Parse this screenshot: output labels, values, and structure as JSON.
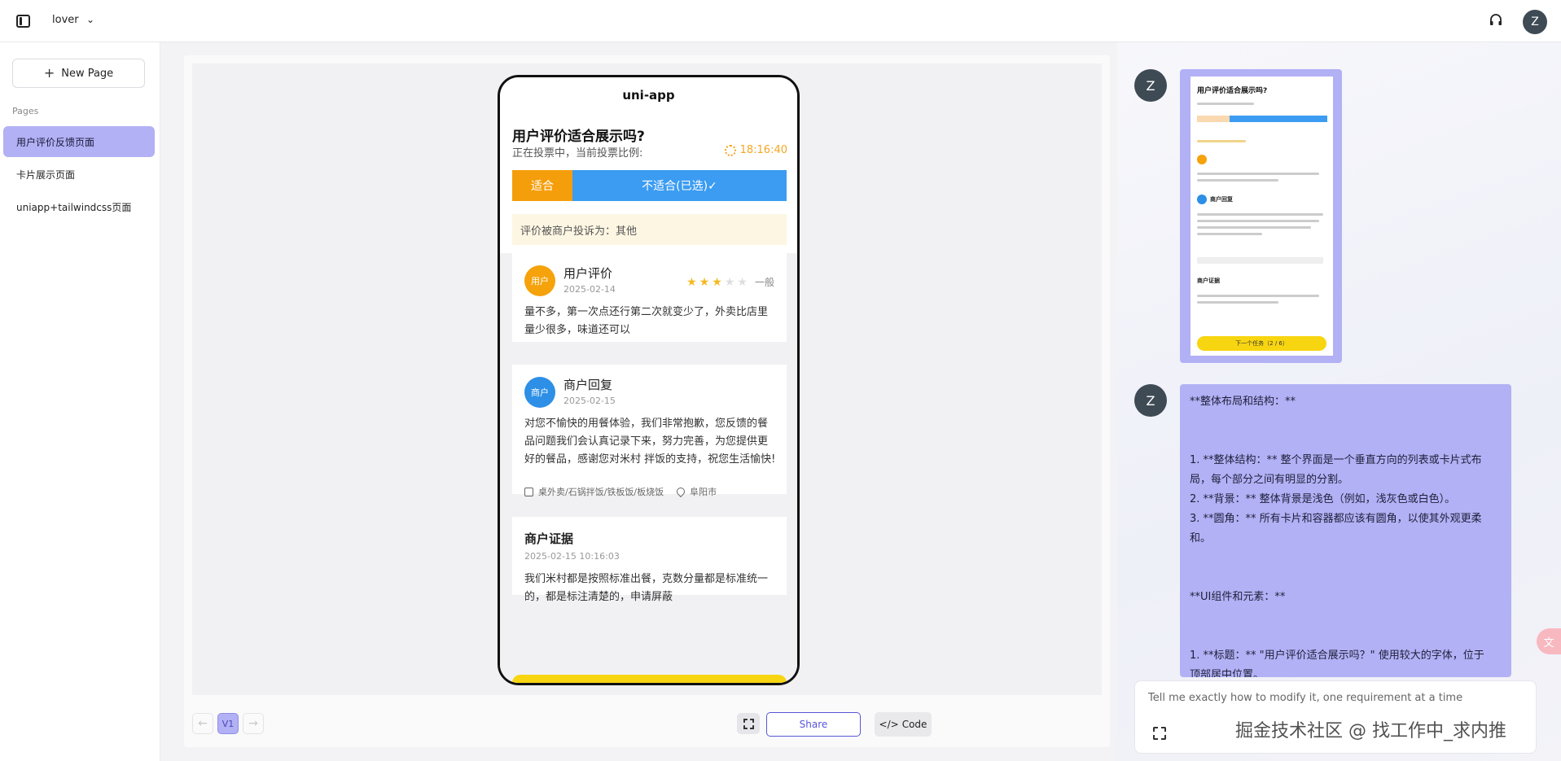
{
  "topbar": {
    "project_name": "lover",
    "user_initial": "Z"
  },
  "sidebar": {
    "new_page_label": "New Page",
    "pages_label": "Pages",
    "items": [
      {
        "label": "用户评价反馈页面",
        "active": true
      },
      {
        "label": "卡片展示页面",
        "active": false
      },
      {
        "label": "uniapp+tailwindcss页面",
        "active": false
      }
    ]
  },
  "phone": {
    "app_title": "uni-app",
    "question_title": "用户评价适合展示吗?",
    "vote_status": "正在投票中，当前投票比例:",
    "timer": "18:16:40",
    "vote_suitable": "适合",
    "vote_unsuitable": "不适合(已选)✓",
    "complaint": "评价被商户投诉为：其他",
    "review": {
      "avatar_label": "用户",
      "name": "用户评价",
      "date": "2025-02-14",
      "rating": 3,
      "rating_max": 5,
      "rating_text": "一般",
      "text": "量不多，第一次点还行第二次就变少了，外卖比店里量少很多，味道还可以"
    },
    "reply": {
      "avatar_label": "商户",
      "name": "商户回复",
      "date": "2025-02-15",
      "text": "对您不愉快的用餐体验，我们非常抱歉，您反馈的餐品问题我们会认真记录下来，努力完善，为您提供更好的餐品，感谢您对米村 拌饭的支持，祝您生活愉快!",
      "shop_category": "桌外卖/石锅拌饭/铁板饭/板烧饭",
      "city": "阜阳市"
    },
    "evidence": {
      "title": "商户证据",
      "datetime": "2025-02-15 10:16:03",
      "text": "我们米村都是按照标准出餐，克数分量都是标准统一的，都是标注清楚的，申请屏蔽"
    }
  },
  "toolbar": {
    "prev_arrow": "←",
    "next_arrow": "→",
    "version": "V1",
    "share_label": "Share",
    "code_label": "Code",
    "code_glyph": "</>"
  },
  "chat": {
    "user_initial": "Z",
    "thumbnail": {
      "title": "用户评价适合展示吗?",
      "section_reply": "商户回复",
      "section_evidence": "商户证据",
      "next_task": "下一个任务（2 / 6）"
    },
    "message_lines": [
      "**整体布局和结构：**",
      "",
      "1. **整体结构：** 整个界面是一个垂直方向的列表或卡片式布",
      "局，每个部分之间有明显的分割。",
      "2. **背景：** 整体背景是浅色（例如，浅灰色或白色）。",
      "3. **圆角：** 所有卡片和容器都应该有圆角，以使其外观更柔",
      "和。",
      "",
      "**UI组件和元素：**",
      "",
      "1. **标题：** \"用户评价适合展示吗？\" 使用较大的字体，位于",
      "顶部居中位置。"
    ],
    "input_placeholder": "Tell me exactly how to modify it, one requirement at a time"
  },
  "watermark": "掘金技术社区 @ 找工作中_求内推",
  "colors": {
    "accent": "#b2b1f5",
    "brand_purple": "#5856d6",
    "vote_orange": "#f59e0b",
    "vote_blue": "#3b9cf2",
    "star": "#f5b921"
  }
}
